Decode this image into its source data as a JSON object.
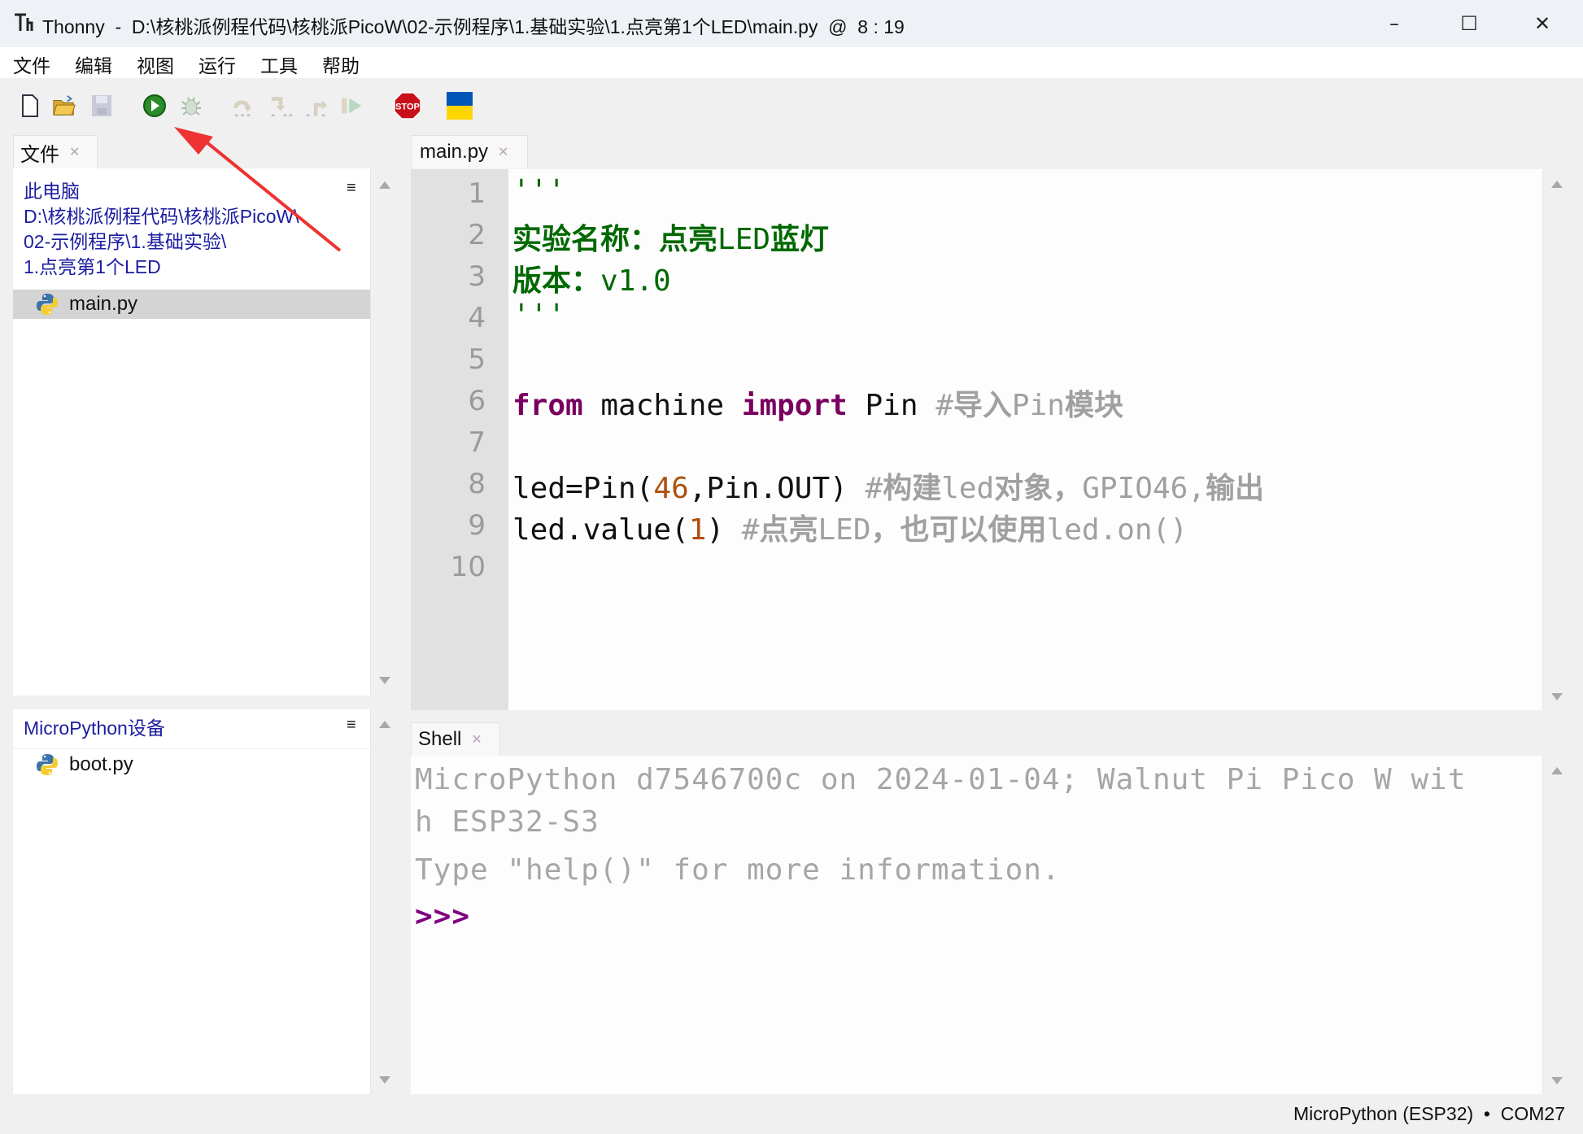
{
  "window": {
    "app_name": "Thonny",
    "title": "Thonny  -  D:\\核桃派例程代码\\核桃派PicoW\\02-示例程序\\1.基础实验\\1.点亮第1个LED\\main.py  @  8 : 19",
    "minimize_icon": "–",
    "maximize_icon": "☐",
    "close_icon": "✕"
  },
  "menu": [
    "文件",
    "编辑",
    "视图",
    "运行",
    "工具",
    "帮助"
  ],
  "toolbar": {
    "buttons": [
      {
        "name": "new-file",
        "enabled": true
      },
      {
        "name": "open-file",
        "enabled": true
      },
      {
        "name": "save-file",
        "enabled": false
      },
      {
        "name": "run",
        "enabled": true
      },
      {
        "name": "debug",
        "enabled": false
      },
      {
        "name": "step-over",
        "enabled": false
      },
      {
        "name": "step-into",
        "enabled": false
      },
      {
        "name": "step-out",
        "enabled": false
      },
      {
        "name": "resume",
        "enabled": false
      },
      {
        "name": "stop",
        "enabled": true,
        "label": "STOP"
      },
      {
        "name": "ukraine-flag",
        "enabled": true
      }
    ]
  },
  "files_panel": {
    "tab_label": "文件",
    "computer_section": {
      "header": "此电脑",
      "path_lines": [
        "D:\\核桃派例程代码\\核桃派PicoW\\",
        "02-示例程序\\1.基础实验\\",
        "1.点亮第1个LED"
      ],
      "files": [
        {
          "name": "main.py",
          "selected": true
        }
      ]
    },
    "device_section": {
      "header": "MicroPython设备",
      "files": [
        {
          "name": "boot.py",
          "selected": false
        }
      ]
    },
    "menu_icon": "≡"
  },
  "editor": {
    "tab_label": "main.py",
    "line_numbers": [
      "1",
      "2",
      "3",
      "4",
      "5",
      "6",
      "7",
      "8",
      "9",
      "10"
    ],
    "lines": {
      "l1": "'''",
      "l2a": "实验名称：点亮",
      "l2b": "LED",
      "l2c": "蓝灯",
      "l3a": "版本：",
      "l3b": "v1.0",
      "l4": "'''",
      "l6_from": "from",
      "l6_mid": " machine ",
      "l6_import": "import",
      "l6_pin": " Pin ",
      "l6_cm1": "#",
      "l6_cm2": "导入",
      "l6_cm3": "Pin",
      "l6_cm4": "模块",
      "l8_a": "led=Pin(",
      "l8_num": "46",
      "l8_b": ",Pin.OUT) ",
      "l8_cm1": "#",
      "l8_cm2": "构建",
      "l8_cm3": "led",
      "l8_cm4": "对象，",
      "l8_cm5": "GPIO46,",
      "l8_cm6": "输出",
      "l9_a": "led.value(",
      "l9_num": "1",
      "l9_b": ") ",
      "l9_cm1": "#",
      "l9_cm2": "点亮",
      "l9_cm3": "LED",
      "l9_cm4": "，也可以使用",
      "l9_cm5": "led.on()"
    },
    "cursor": "8 : 19"
  },
  "shell": {
    "tab_label": "Shell",
    "lines": [
      "MicroPython d7546700c on 2024-01-04; Walnut Pi Pico W wit",
      "h ESP32-S3",
      "Type \"help()\" for more information."
    ],
    "prompt": ">>>"
  },
  "statusbar": {
    "text": "MicroPython (ESP32)  •  COM27"
  },
  "annotation": {
    "color": "#ee3333",
    "points_to": "run-button"
  },
  "colors": {
    "string": "#006800",
    "keyword": "#7a0060",
    "number": "#b05010",
    "comment": "#a0a0a0",
    "path": "#1c1ca0",
    "prompt": "#800080"
  }
}
